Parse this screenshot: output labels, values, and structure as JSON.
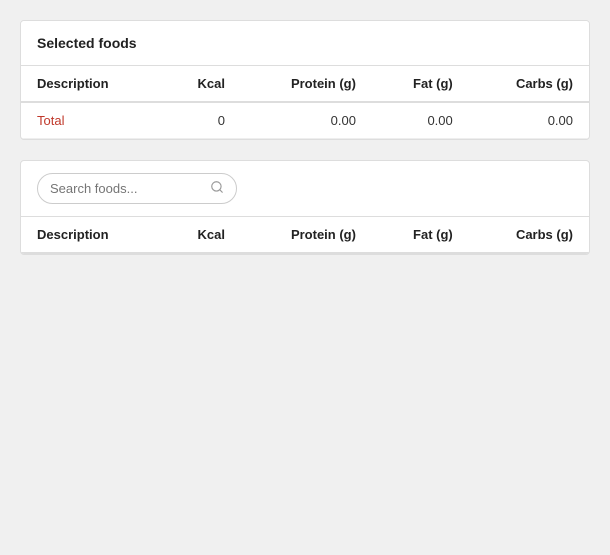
{
  "selected_foods_panel": {
    "title": "Selected foods",
    "table": {
      "columns": [
        {
          "label": "Description",
          "key": "description",
          "type": "text"
        },
        {
          "label": "Kcal",
          "key": "kcal",
          "type": "num"
        },
        {
          "label": "Protein (g)",
          "key": "protein",
          "type": "num"
        },
        {
          "label": "Fat (g)",
          "key": "fat",
          "type": "num"
        },
        {
          "label": "Carbs (g)",
          "key": "carbs",
          "type": "num"
        }
      ],
      "rows": [],
      "total_row": {
        "label": "Total",
        "kcal": "0",
        "protein": "0.00",
        "fat": "0.00",
        "carbs": "0.00"
      }
    }
  },
  "search_panel": {
    "search_placeholder": "Search foods...",
    "table": {
      "columns": [
        {
          "label": "Description",
          "key": "description",
          "type": "text"
        },
        {
          "label": "Kcal",
          "key": "kcal",
          "type": "num"
        },
        {
          "label": "Protein (g)",
          "key": "protein",
          "type": "num"
        },
        {
          "label": "Fat (g)",
          "key": "fat",
          "type": "num"
        },
        {
          "label": "Carbs (g)",
          "key": "carbs",
          "type": "num"
        }
      ],
      "rows": []
    }
  }
}
